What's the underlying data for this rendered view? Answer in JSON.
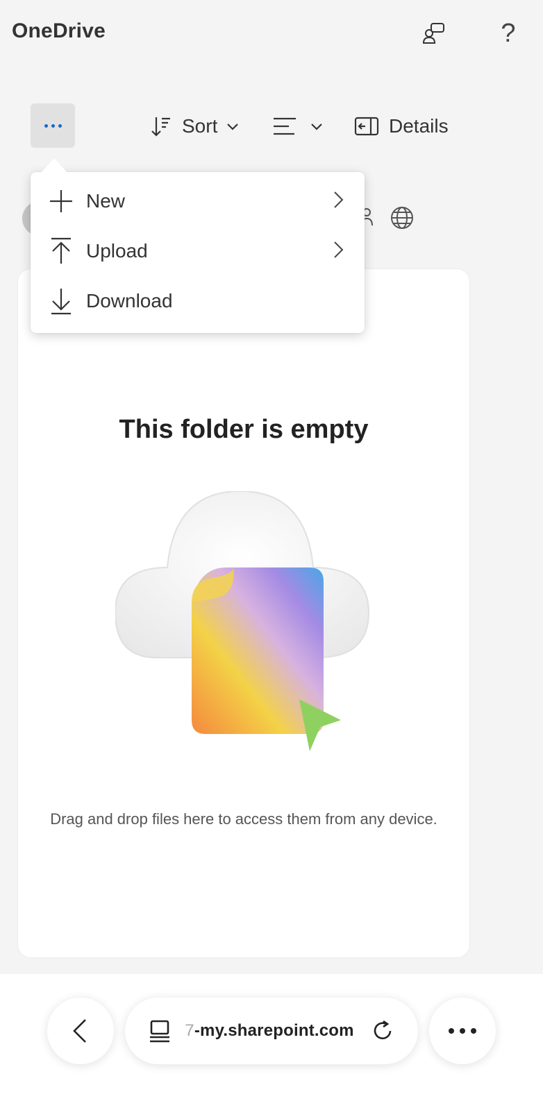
{
  "app": {
    "title": "OneDrive"
  },
  "topbar": {
    "feedback_icon": "feedback-icon",
    "help_icon": "?"
  },
  "commandbar": {
    "more_icon": "ellipsis-icon",
    "sort_label": "Sort",
    "view_icon": "view-options-icon",
    "details_label": "Details"
  },
  "menu": {
    "items": [
      {
        "label": "New",
        "icon": "plus-icon",
        "has_submenu": true
      },
      {
        "label": "Upload",
        "icon": "upload-icon",
        "has_submenu": true
      },
      {
        "label": "Download",
        "icon": "download-icon",
        "has_submenu": false
      }
    ]
  },
  "empty_state": {
    "title": "This folder is empty",
    "description": "Drag and drop files here to access them from any device."
  },
  "browser": {
    "url_prefix": "7",
    "url": "-my.sharepoint.com"
  },
  "colors": {
    "accent": "#1a66c6",
    "background": "#f4f4f4"
  }
}
